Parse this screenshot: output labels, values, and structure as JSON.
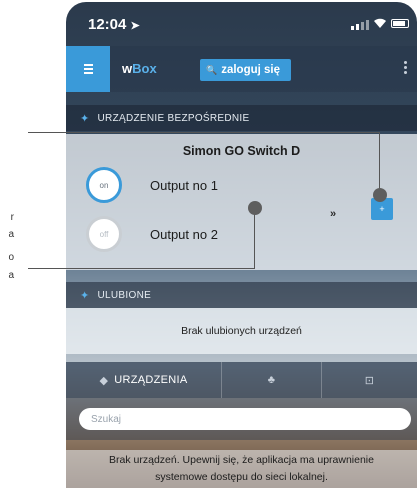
{
  "annotations": [
    "r",
    "a",
    "o",
    "a"
  ],
  "status_bar": {
    "time": "12:04"
  },
  "app_bar": {
    "brand_prefix": "w",
    "brand_suffix": "Box",
    "login_label": "zaloguj się",
    "menu_icon": "hamburger-icon",
    "more_icon": "kebab-icon"
  },
  "direct_device": {
    "header": "URZĄDZENIE BEZPOŚREDNIE",
    "device_name": "Simon GO Switch D",
    "outputs": [
      {
        "state_label": "on",
        "label": "Output no 1"
      },
      {
        "state_label": "off",
        "label": "Output no 2"
      }
    ],
    "chevron": "»",
    "plus_label": "+"
  },
  "favorites": {
    "header": "ULUBIONE",
    "empty_text": "Brak ulubionych urządzeń"
  },
  "tabs": [
    {
      "label": "URZĄDZENIA",
      "icon": "cube-icon"
    },
    {
      "label": "",
      "icon": "network-icon"
    },
    {
      "label": "",
      "icon": "scenes-icon"
    }
  ],
  "search": {
    "placeholder": "Szukaj"
  },
  "no_devices": {
    "line1": "Brak urządzeń. Upewnij się, że aplikacja ma uprawnienie",
    "line2": "systemowe dostępu do sieci lokalnej."
  },
  "colors": {
    "accent": "#3a9ad9",
    "header_bg": "#28374b"
  }
}
